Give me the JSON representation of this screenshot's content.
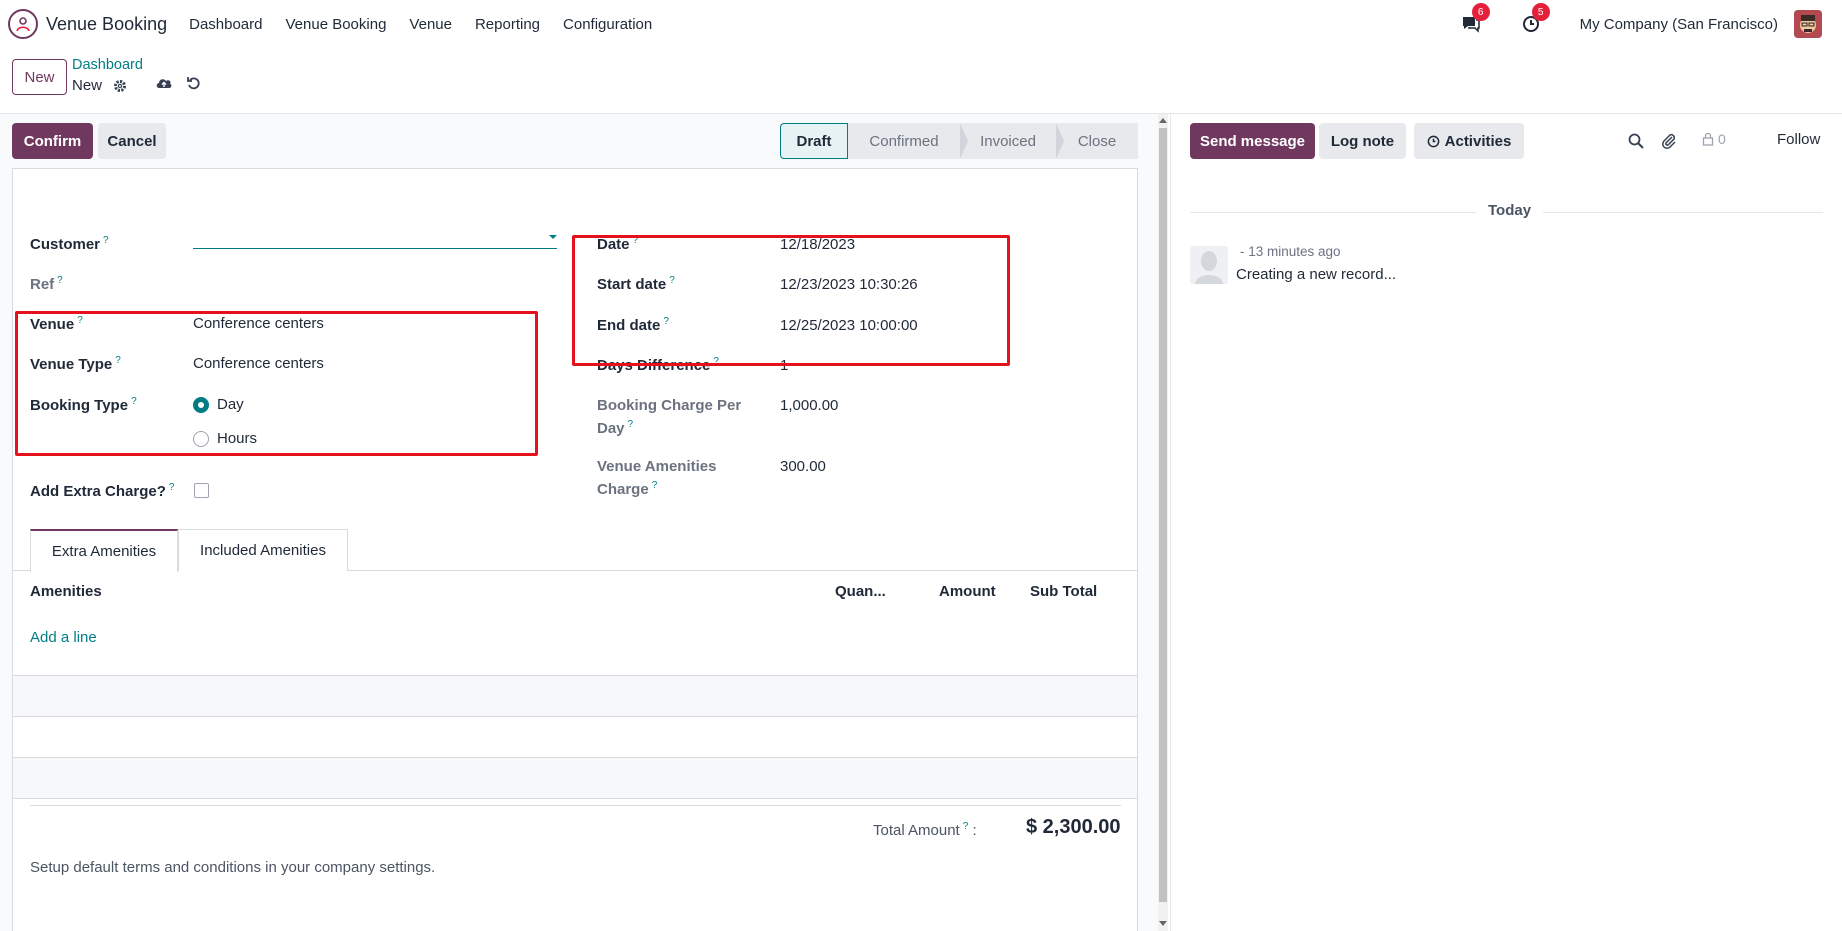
{
  "navbar": {
    "app_name": "Venue Booking",
    "menu": [
      "Dashboard",
      "Venue Booking",
      "Venue",
      "Reporting",
      "Configuration"
    ],
    "messages_badge": "6",
    "activities_badge": "5",
    "company": "My Company (San Francisco)"
  },
  "control_panel": {
    "new_label": "New",
    "breadcrumb_parent": "Dashboard",
    "breadcrumb_current": "New"
  },
  "form": {
    "confirm_label": "Confirm",
    "cancel_label": "Cancel",
    "stages": [
      "Draft",
      "Confirmed",
      "Invoiced",
      "Close"
    ],
    "active_stage": "Draft",
    "help_mark": "?",
    "left": {
      "customer_label": "Customer",
      "customer_value": "",
      "ref_label": "Ref",
      "venue_label": "Venue",
      "venue_value": "Conference centers",
      "venue_type_label": "Venue Type",
      "venue_type_value": "Conference centers",
      "booking_type_label": "Booking Type",
      "booking_options": [
        "Day",
        "Hours"
      ],
      "booking_selected": "Day",
      "extra_charge_label": "Add Extra Charge?",
      "extra_charge_checked": false
    },
    "right": {
      "date_label": "Date",
      "date_value": "12/18/2023",
      "start_label": "Start date",
      "start_value": "12/23/2023 10:30:26",
      "end_label": "End date",
      "end_value": "12/25/2023 10:00:00",
      "days_label": "Days Difference",
      "days_value": "1",
      "charge_label_1": "Booking Charge Per",
      "charge_label_2": "Day",
      "charge_value": "1,000.00",
      "amenities_label_1": "Venue Amenities",
      "amenities_label_2": "Charge",
      "amenities_value": "300.00"
    },
    "tabs": [
      "Extra Amenities",
      "Included Amenities"
    ],
    "active_tab": "Extra Amenities",
    "table": {
      "columns": [
        "Amenities",
        "Quan...",
        "Amount",
        "Sub Total"
      ],
      "add_line": "Add a line"
    },
    "total_label": "Total Amount",
    "total_colon": ":",
    "total_value": "$ 2,300.00",
    "terms": "Setup default terms and conditions in your company settings."
  },
  "chatter": {
    "send_message": "Send message",
    "log_note": "Log note",
    "activities": "Activities",
    "followers_count": "0",
    "follow": "Follow",
    "today": "Today",
    "message_time": "- 13 minutes ago",
    "message_body": "Creating a new record..."
  },
  "colors": {
    "brand": "#71385f",
    "link": "#017e84",
    "highlight_box": "#e5111b",
    "badge": "#e5203a"
  }
}
